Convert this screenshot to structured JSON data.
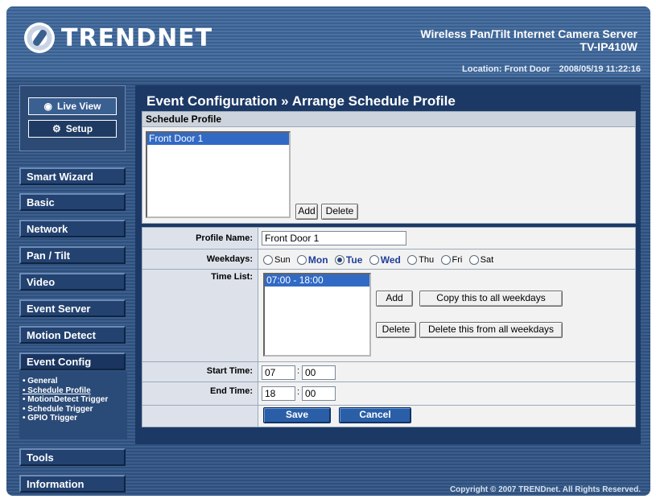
{
  "header": {
    "brand": "TRENDNET",
    "product_name": "Wireless Pan/Tilt Internet Camera Server",
    "model": "TV-IP410W",
    "location_label": "Location: Front Door",
    "datetime": "2008/05/19 11:22:16"
  },
  "view_buttons": {
    "live_view": "Live View",
    "setup": "Setup"
  },
  "nav": {
    "smart_wizard": "Smart Wizard",
    "basic": "Basic",
    "network": "Network",
    "pan_tilt": "Pan / Tilt",
    "video": "Video",
    "event_server": "Event Server",
    "motion_detect": "Motion Detect",
    "event_config": "Event Config",
    "tools": "Tools",
    "information": "Information",
    "event_config_sub": {
      "general": "• General",
      "schedule_profile": "• Schedule Profile",
      "motiondetect_trigger": "• MotionDetect Trigger",
      "schedule_trigger": "• Schedule Trigger",
      "gpio_trigger": "• GPIO Trigger"
    }
  },
  "main": {
    "title": "Event Configuration » Arrange Schedule Profile",
    "schedule_profile": {
      "heading": "Schedule Profile",
      "profiles": [
        "Front Door 1"
      ],
      "add_label": "Add",
      "delete_label": "Delete"
    },
    "form": {
      "profile_name_label": "Profile Name:",
      "profile_name_value": "Front Door 1",
      "weekdays_label": "Weekdays:",
      "weekdays": [
        {
          "label": "Sun",
          "checked": false,
          "bold": false
        },
        {
          "label": "Mon",
          "checked": false,
          "bold": true
        },
        {
          "label": "Tue",
          "checked": true,
          "bold": true
        },
        {
          "label": "Wed",
          "checked": false,
          "bold": true
        },
        {
          "label": "Thu",
          "checked": false,
          "bold": false
        },
        {
          "label": "Fri",
          "checked": false,
          "bold": false
        },
        {
          "label": "Sat",
          "checked": false,
          "bold": false
        }
      ],
      "time_list_label": "Time List:",
      "time_list": [
        "07:00 - 18:00"
      ],
      "time_add_label": "Add",
      "copy_all_label": "Copy this to all weekdays",
      "time_delete_label": "Delete",
      "delete_all_label": "Delete this from all weekdays",
      "start_time_label": "Start Time:",
      "start_hour": "07",
      "start_minute": "00",
      "end_time_label": "End Time:",
      "end_hour": "18",
      "end_minute": "00",
      "time_separator": ":",
      "save_label": "Save",
      "cancel_label": "Cancel"
    }
  },
  "footer": {
    "copyright": "Copyright © 2007 TRENDnet. All Rights Reserved."
  }
}
